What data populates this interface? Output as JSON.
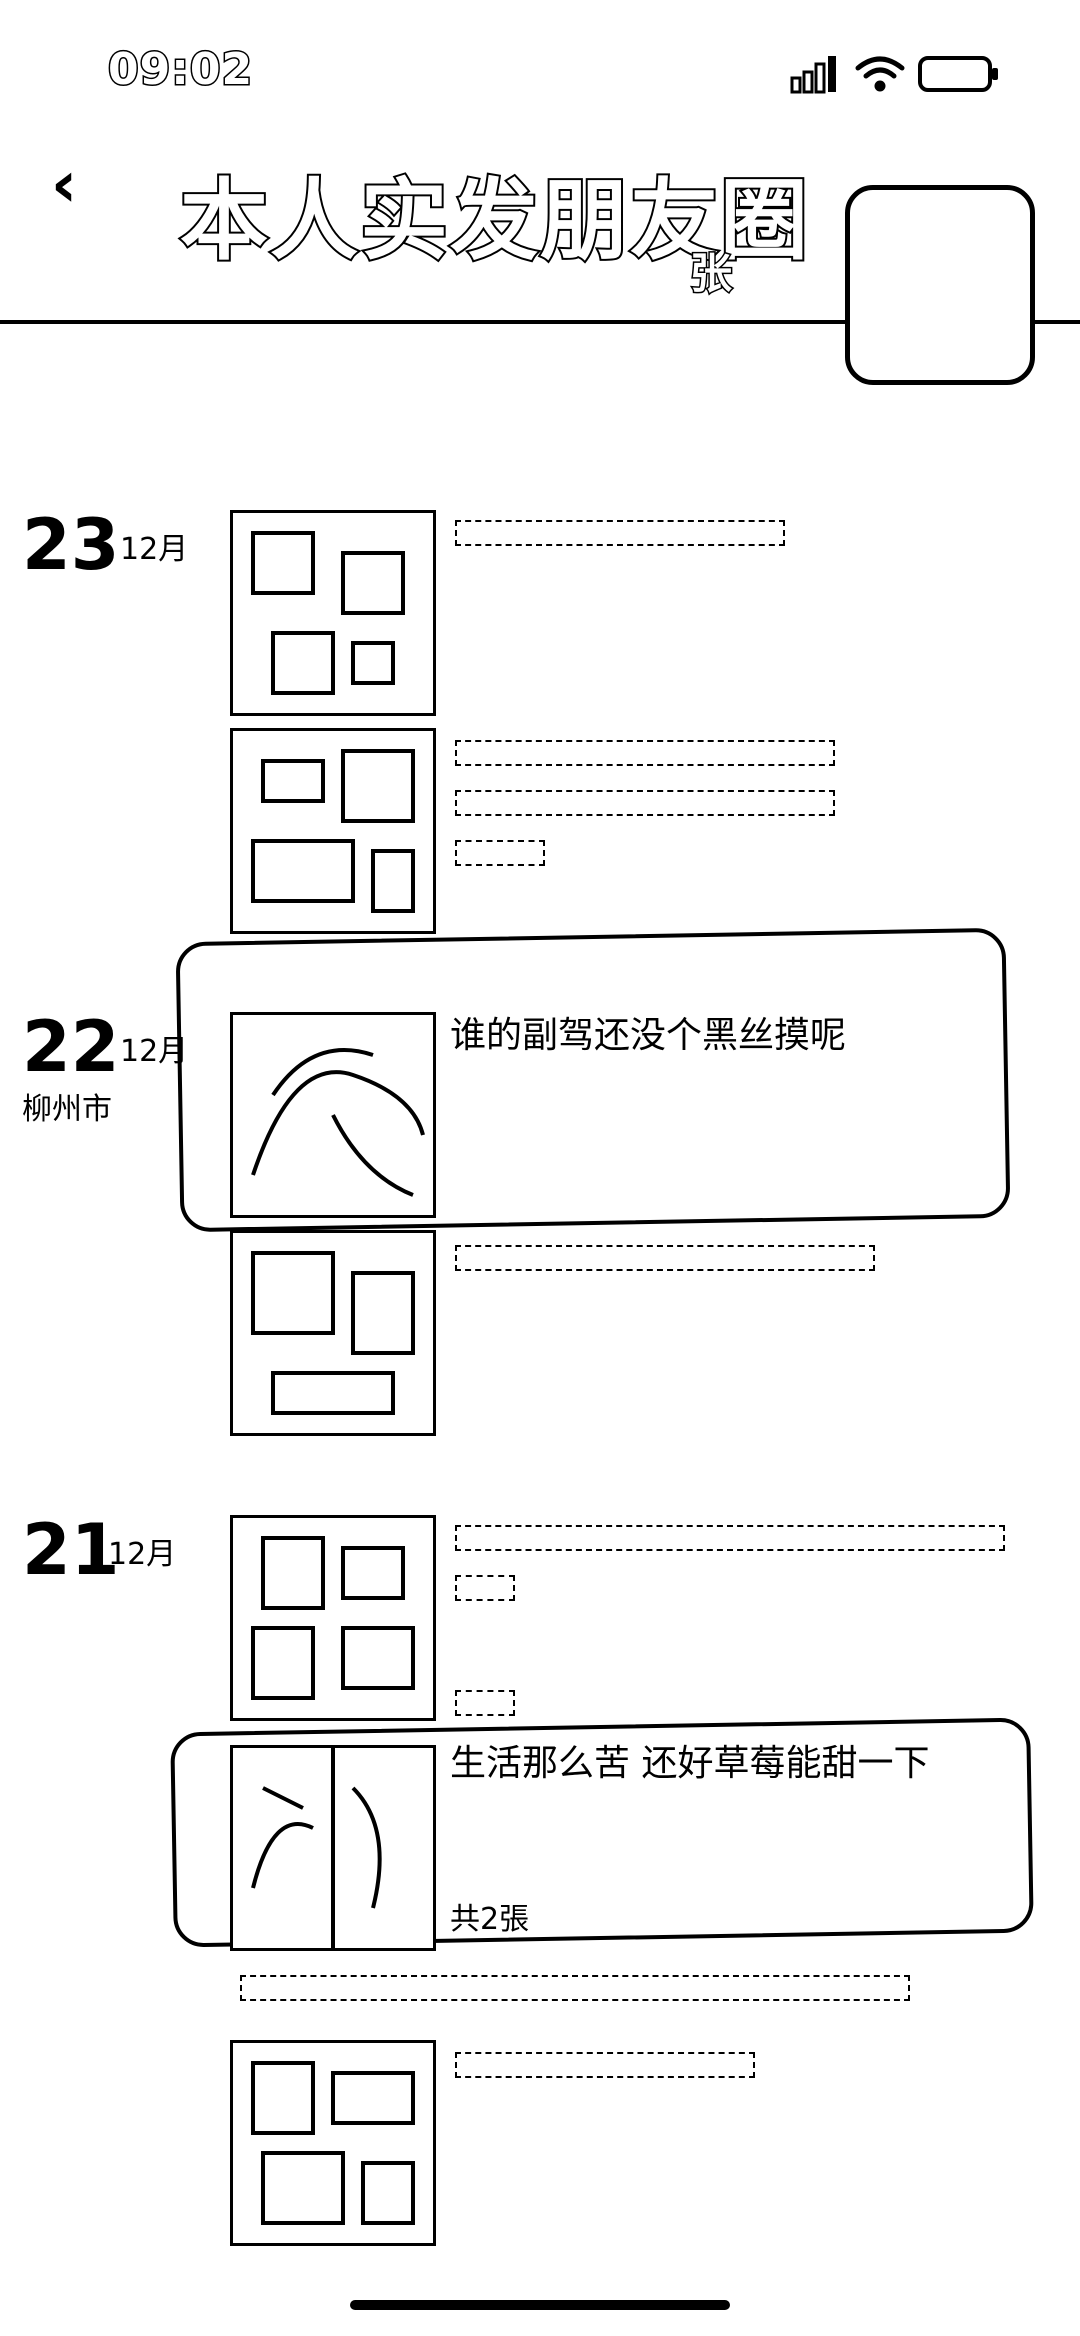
{
  "status_bar": {
    "time": "09:02"
  },
  "header": {
    "back_icon": "chevron-left-icon",
    "title": "本人实发朋友圈",
    "subtitle": "张"
  },
  "posts": {
    "d23": {
      "day": "23",
      "month": "12月"
    },
    "d22": {
      "day": "22",
      "month": "12月",
      "location": "柳州市",
      "text": "谁的副驾还没个黑丝摸呢"
    },
    "d21": {
      "day": "21",
      "month": "12月",
      "text": "生活那么苦 还好草莓能甜一下",
      "photo_count": "共2張"
    }
  }
}
